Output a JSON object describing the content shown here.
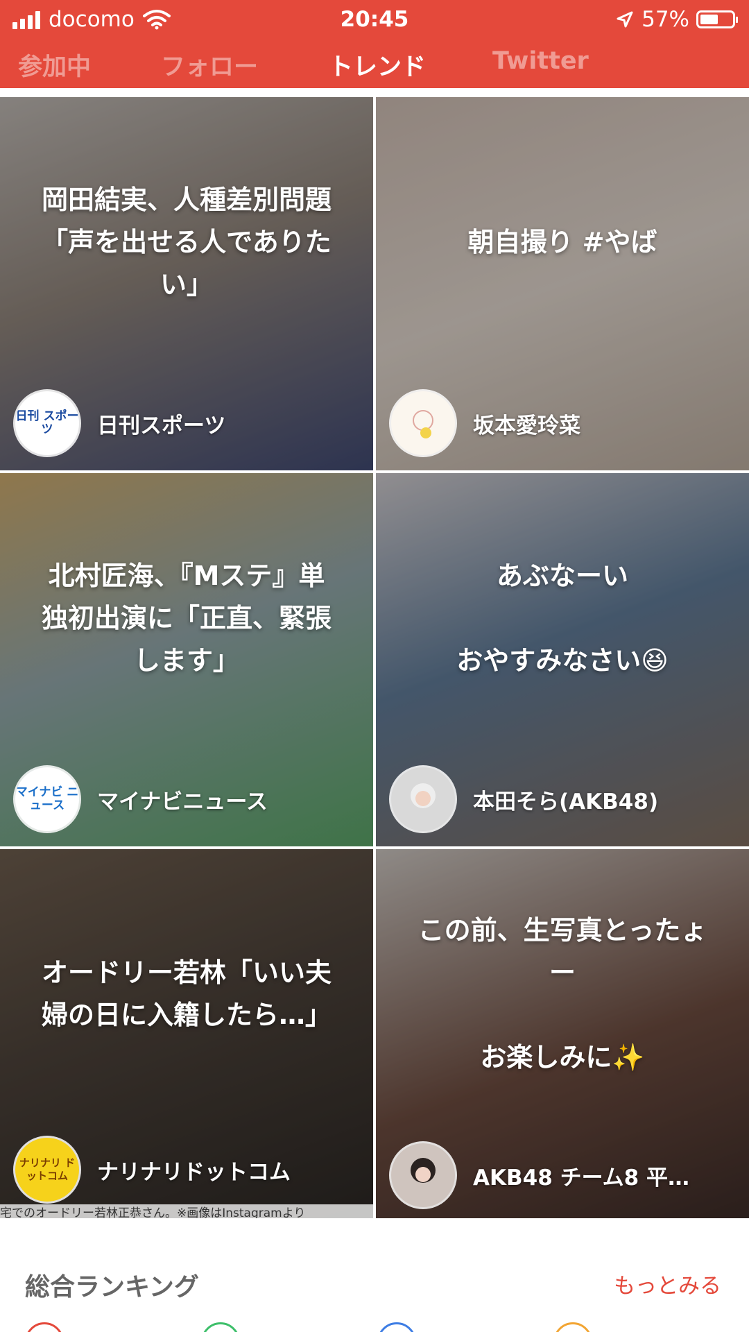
{
  "status_bar": {
    "carrier": "docomo",
    "time": "20:45",
    "battery": "57%",
    "battery_level": 0.57
  },
  "tabs": [
    {
      "label": "参加中",
      "active": false
    },
    {
      "label": "フォロー",
      "active": false
    },
    {
      "label": "トレンド",
      "active": true
    },
    {
      "label": "Twitter",
      "active": false
    }
  ],
  "cards": [
    {
      "title": "岡田結実、人種差別問題\n「声を出せる人でありた\nい」",
      "source": "日刊スポーツ",
      "avatar_text": "日刊\nスポーツ"
    },
    {
      "title": "朝自撮り #やば",
      "source": "坂本愛玲菜",
      "avatar_text": ""
    },
    {
      "title": "北村匠海、『Mステ』単\n独初出演に「正直、緊張\nします」",
      "source": "マイナビニュース",
      "avatar_text": "マイナビ\nニュース"
    },
    {
      "title": "あぶなーい\n\nおやすみなさい😆",
      "source": "本田そら(AKB48)",
      "avatar_text": ""
    },
    {
      "title": "オードリー若林「いい夫\n婦の日に入籍したら…」",
      "source": "ナリナリドットコム",
      "avatar_text": "ナリナリ\nドットコム",
      "caption": "宅でのオードリー若林正恭さん。※画像はInstagramより"
    },
    {
      "title": "この前、生写真とったょ\nー\n\nお楽しみに✨",
      "source": "AKB48 チーム8 平…",
      "avatar_text": ""
    }
  ],
  "ranking": {
    "title": "総合ランキング",
    "more": "もっとみる"
  },
  "colors": {
    "header_red": "#E4493B"
  }
}
